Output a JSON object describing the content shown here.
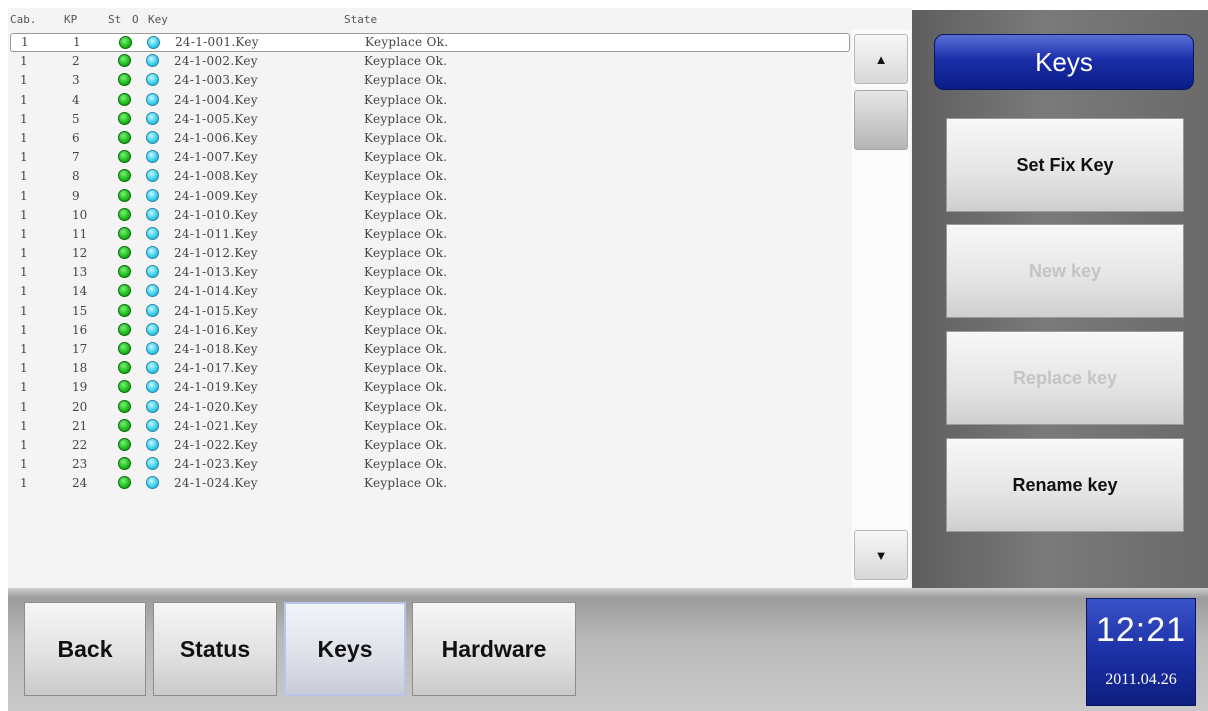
{
  "list": {
    "columns": {
      "cab": "Cab.",
      "kp": "KP",
      "st": "St",
      "o": "O",
      "key": "Key",
      "state": "State"
    },
    "rows": [
      {
        "cab": "1",
        "kp": "1",
        "key": "24-1-001.Key",
        "state": "Keyplace Ok."
      },
      {
        "cab": "1",
        "kp": "2",
        "key": "24-1-002.Key",
        "state": "Keyplace Ok."
      },
      {
        "cab": "1",
        "kp": "3",
        "key": "24-1-003.Key",
        "state": "Keyplace Ok."
      },
      {
        "cab": "1",
        "kp": "4",
        "key": "24-1-004.Key",
        "state": "Keyplace Ok."
      },
      {
        "cab": "1",
        "kp": "5",
        "key": "24-1-005.Key",
        "state": "Keyplace Ok."
      },
      {
        "cab": "1",
        "kp": "6",
        "key": "24-1-006.Key",
        "state": "Keyplace Ok."
      },
      {
        "cab": "1",
        "kp": "7",
        "key": "24-1-007.Key",
        "state": "Keyplace Ok."
      },
      {
        "cab": "1",
        "kp": "8",
        "key": "24-1-008.Key",
        "state": "Keyplace Ok."
      },
      {
        "cab": "1",
        "kp": "9",
        "key": "24-1-009.Key",
        "state": "Keyplace Ok."
      },
      {
        "cab": "1",
        "kp": "10",
        "key": "24-1-010.Key",
        "state": "Keyplace Ok."
      },
      {
        "cab": "1",
        "kp": "11",
        "key": "24-1-011.Key",
        "state": "Keyplace Ok."
      },
      {
        "cab": "1",
        "kp": "12",
        "key": "24-1-012.Key",
        "state": "Keyplace Ok."
      },
      {
        "cab": "1",
        "kp": "13",
        "key": "24-1-013.Key",
        "state": "Keyplace Ok."
      },
      {
        "cab": "1",
        "kp": "14",
        "key": "24-1-014.Key",
        "state": "Keyplace Ok."
      },
      {
        "cab": "1",
        "kp": "15",
        "key": "24-1-015.Key",
        "state": "Keyplace Ok."
      },
      {
        "cab": "1",
        "kp": "16",
        "key": "24-1-016.Key",
        "state": "Keyplace Ok."
      },
      {
        "cab": "1",
        "kp": "17",
        "key": "24-1-018.Key",
        "state": "Keyplace Ok."
      },
      {
        "cab": "1",
        "kp": "18",
        "key": "24-1-017.Key",
        "state": "Keyplace Ok."
      },
      {
        "cab": "1",
        "kp": "19",
        "key": "24-1-019.Key",
        "state": "Keyplace Ok."
      },
      {
        "cab": "1",
        "kp": "20",
        "key": "24-1-020.Key",
        "state": "Keyplace Ok."
      },
      {
        "cab": "1",
        "kp": "21",
        "key": "24-1-021.Key",
        "state": "Keyplace Ok."
      },
      {
        "cab": "1",
        "kp": "22",
        "key": "24-1-022.Key",
        "state": "Keyplace Ok."
      },
      {
        "cab": "1",
        "kp": "23",
        "key": "24-1-023.Key",
        "state": "Keyplace Ok."
      },
      {
        "cab": "1",
        "kp": "24",
        "key": "24-1-024.Key",
        "state": "Keyplace Ok."
      }
    ],
    "selected_index": 0,
    "status_colors": {
      "st": "#1fbf1f",
      "o": "#3cd0f0"
    }
  },
  "scrollbar": {
    "up_icon": "triangle-up-icon",
    "down_icon": "triangle-down-icon",
    "up_glyph": "▲",
    "down_glyph": "▼"
  },
  "panel": {
    "title": "Keys",
    "buttons": {
      "set_fix_key": "Set Fix Key",
      "new_key": "New key",
      "replace_key": "Replace key",
      "rename_key": "Rename key"
    }
  },
  "nav": {
    "back": "Back",
    "status": "Status",
    "keys": "Keys",
    "hardware": "Hardware",
    "active": "keys"
  },
  "clock": {
    "time": "12:21",
    "date": "2011.04.26"
  },
  "colors": {
    "accent_blue": "#1a2fa8",
    "disabled_text": "#c4c4c4"
  }
}
